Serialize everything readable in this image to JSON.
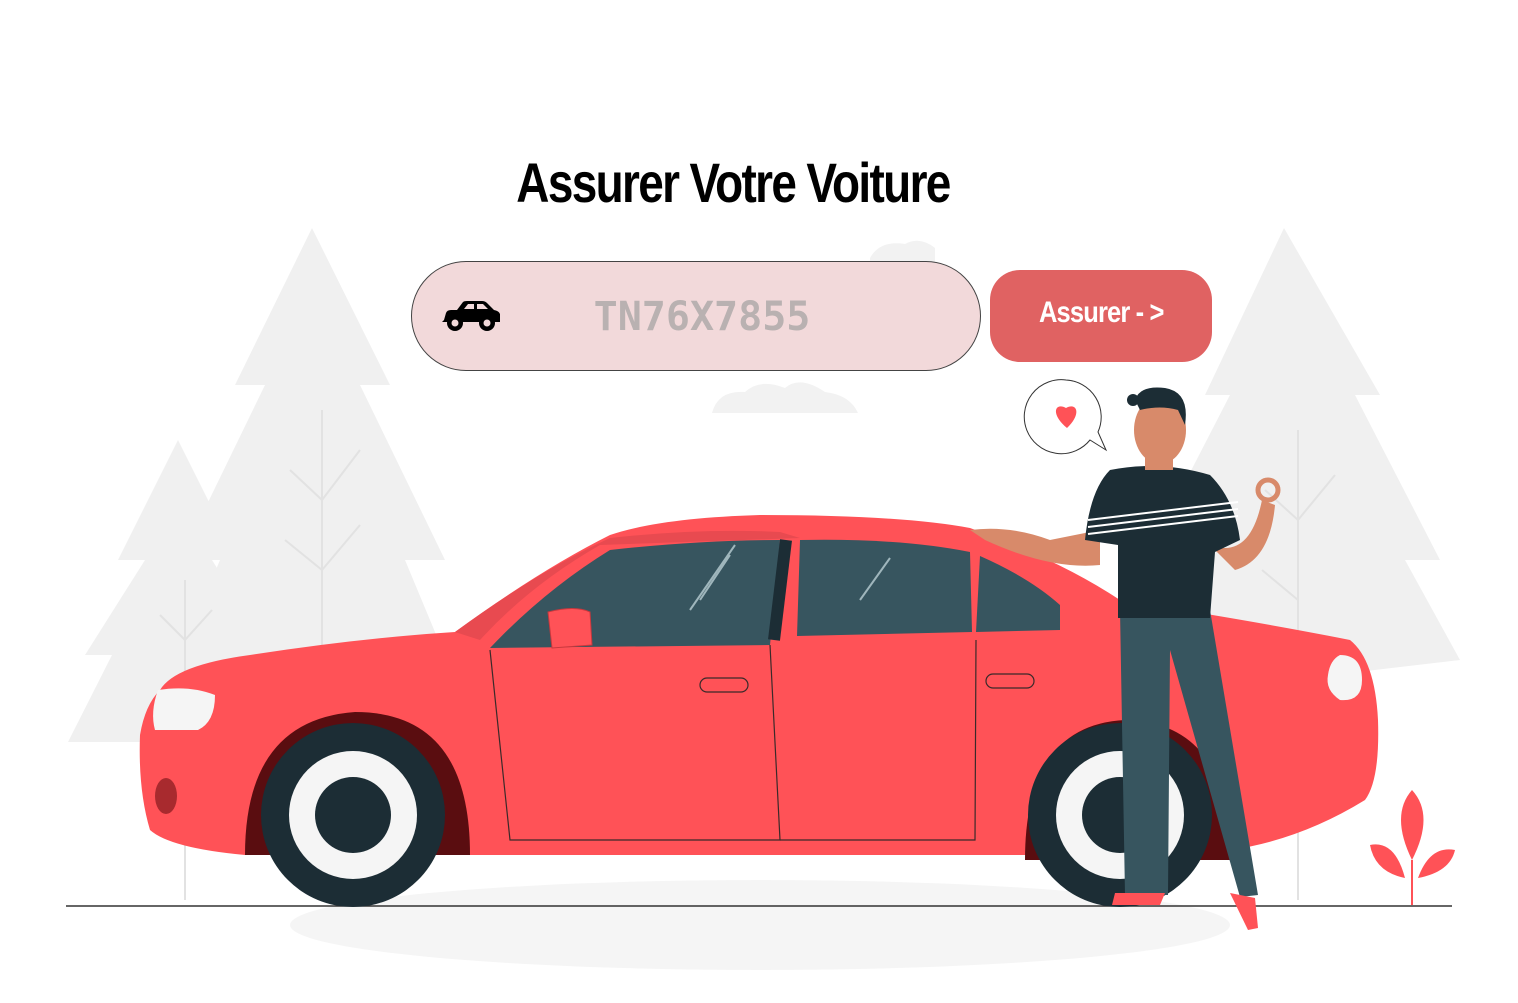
{
  "page": {
    "title": "Assurer Votre Voiture"
  },
  "form": {
    "plate_input": {
      "value": "",
      "placeholder": "TN76X7855",
      "icon": "car-icon"
    },
    "submit_label": "Assurer - >"
  },
  "colors": {
    "accent": "#e06262",
    "input_background": "#f2d9da",
    "car_body": "#ff5257",
    "dark": "#1c2d35",
    "tree": "#f0f0f0"
  }
}
